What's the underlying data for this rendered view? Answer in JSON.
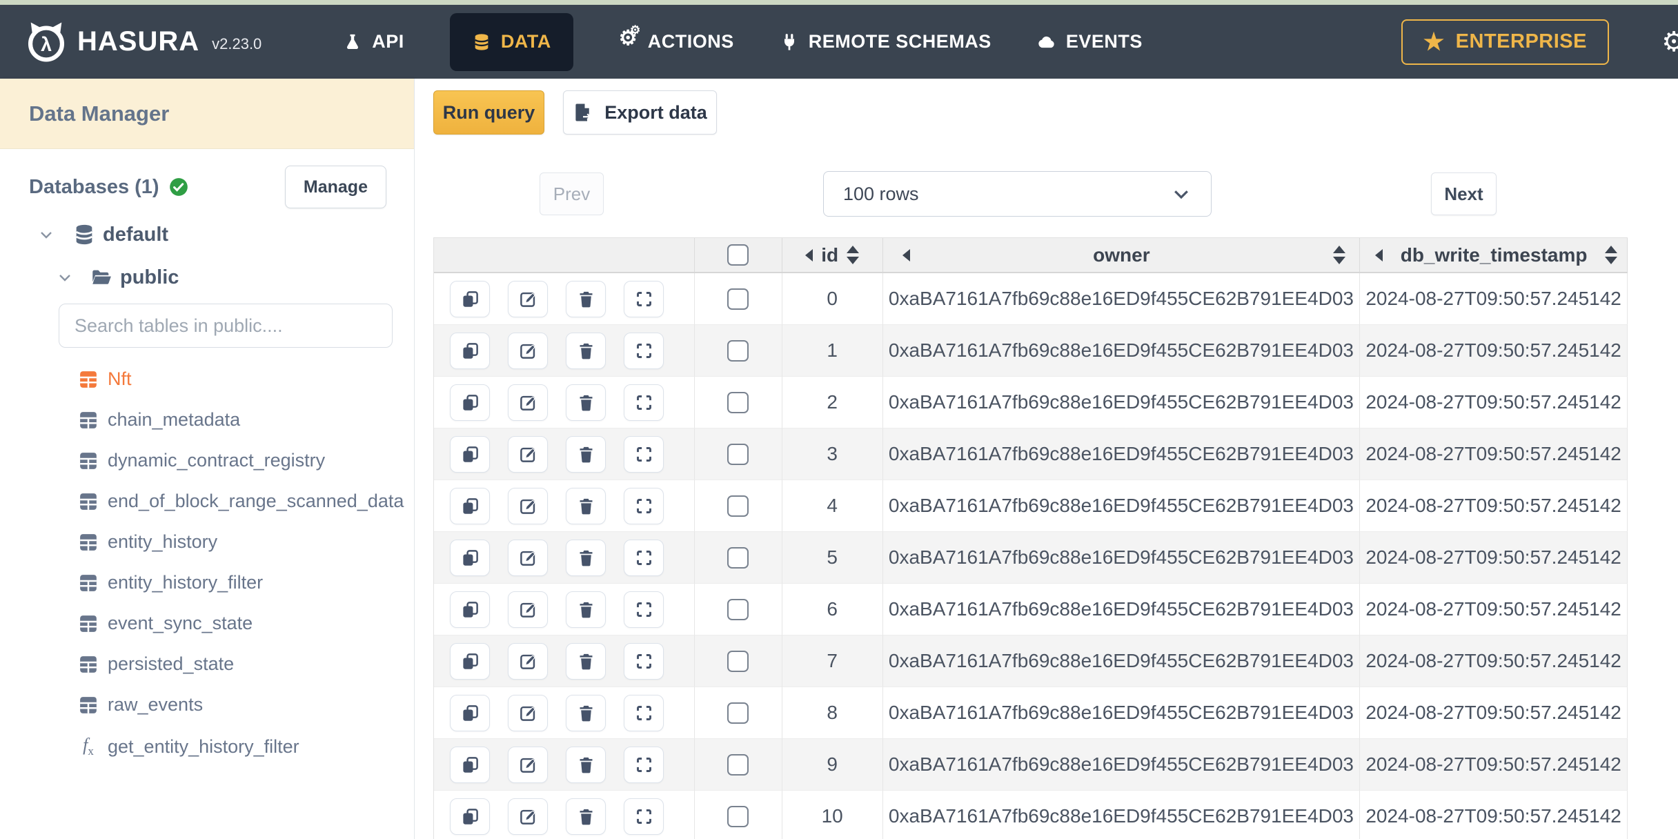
{
  "nav": {
    "brand": "HASURA",
    "version": "v2.23.0",
    "items": [
      {
        "label": "API",
        "icon": "flask-icon",
        "active": false
      },
      {
        "label": "DATA",
        "icon": "database-icon",
        "active": true
      },
      {
        "label": "ACTIONS",
        "icon": "gears-icon",
        "active": false
      },
      {
        "label": "REMOTE SCHEMAS",
        "icon": "plug-icon",
        "active": false
      },
      {
        "label": "EVENTS",
        "icon": "cloud-icon",
        "active": false
      }
    ],
    "enterprise_label": "ENTERPRISE",
    "colors": {
      "bar": "#3a4450",
      "active_tab_bg": "#151d2a",
      "accent": "#efb649"
    }
  },
  "sidebar": {
    "title": "Data Manager",
    "databases_label": "Databases (1)",
    "manage_label": "Manage",
    "tree": {
      "database": "default",
      "schema": "public"
    },
    "search_placeholder": "Search tables in public....",
    "tables": [
      {
        "name": "Nft",
        "type": "table",
        "selected": true
      },
      {
        "name": "chain_metadata",
        "type": "table",
        "selected": false
      },
      {
        "name": "dynamic_contract_registry",
        "type": "table",
        "selected": false
      },
      {
        "name": "end_of_block_range_scanned_data",
        "type": "table",
        "selected": false
      },
      {
        "name": "entity_history",
        "type": "table",
        "selected": false
      },
      {
        "name": "entity_history_filter",
        "type": "table",
        "selected": false
      },
      {
        "name": "event_sync_state",
        "type": "table",
        "selected": false
      },
      {
        "name": "persisted_state",
        "type": "table",
        "selected": false
      },
      {
        "name": "raw_events",
        "type": "table",
        "selected": false
      },
      {
        "name": "get_entity_history_filter",
        "type": "function",
        "selected": false
      }
    ],
    "colors": {
      "header_bg": "#fbf0d6",
      "selected_table": "#f4793b",
      "check_green": "#2f9e44"
    }
  },
  "toolbar": {
    "run_query_label": "Run query",
    "export_data_label": "Export data"
  },
  "pagination": {
    "prev_label": "Prev",
    "rows_selected": "100 rows",
    "next_label": "Next"
  },
  "table": {
    "columns": [
      {
        "key": "id",
        "label": "id",
        "sortable": true
      },
      {
        "key": "owner",
        "label": "owner",
        "sortable": true
      },
      {
        "key": "db_write_timestamp",
        "label": "db_write_timestamp",
        "sortable": true
      }
    ],
    "rows": [
      {
        "id": "0",
        "owner": "0xaBA7161A7fb69c88e16ED9f455CE62B791EE4D03",
        "db_write_timestamp": "2024-08-27T09:50:57.245142"
      },
      {
        "id": "1",
        "owner": "0xaBA7161A7fb69c88e16ED9f455CE62B791EE4D03",
        "db_write_timestamp": "2024-08-27T09:50:57.245142"
      },
      {
        "id": "2",
        "owner": "0xaBA7161A7fb69c88e16ED9f455CE62B791EE4D03",
        "db_write_timestamp": "2024-08-27T09:50:57.245142"
      },
      {
        "id": "3",
        "owner": "0xaBA7161A7fb69c88e16ED9f455CE62B791EE4D03",
        "db_write_timestamp": "2024-08-27T09:50:57.245142"
      },
      {
        "id": "4",
        "owner": "0xaBA7161A7fb69c88e16ED9f455CE62B791EE4D03",
        "db_write_timestamp": "2024-08-27T09:50:57.245142"
      },
      {
        "id": "5",
        "owner": "0xaBA7161A7fb69c88e16ED9f455CE62B791EE4D03",
        "db_write_timestamp": "2024-08-27T09:50:57.245142"
      },
      {
        "id": "6",
        "owner": "0xaBA7161A7fb69c88e16ED9f455CE62B791EE4D03",
        "db_write_timestamp": "2024-08-27T09:50:57.245142"
      },
      {
        "id": "7",
        "owner": "0xaBA7161A7fb69c88e16ED9f455CE62B791EE4D03",
        "db_write_timestamp": "2024-08-27T09:50:57.245142"
      },
      {
        "id": "8",
        "owner": "0xaBA7161A7fb69c88e16ED9f455CE62B791EE4D03",
        "db_write_timestamp": "2024-08-27T09:50:57.245142"
      },
      {
        "id": "9",
        "owner": "0xaBA7161A7fb69c88e16ED9f455CE62B791EE4D03",
        "db_write_timestamp": "2024-08-27T09:50:57.245142"
      },
      {
        "id": "10",
        "owner": "0xaBA7161A7fb69c88e16ED9f455CE62B791EE4D03",
        "db_write_timestamp": "2024-08-27T09:50:57.245142"
      }
    ]
  }
}
